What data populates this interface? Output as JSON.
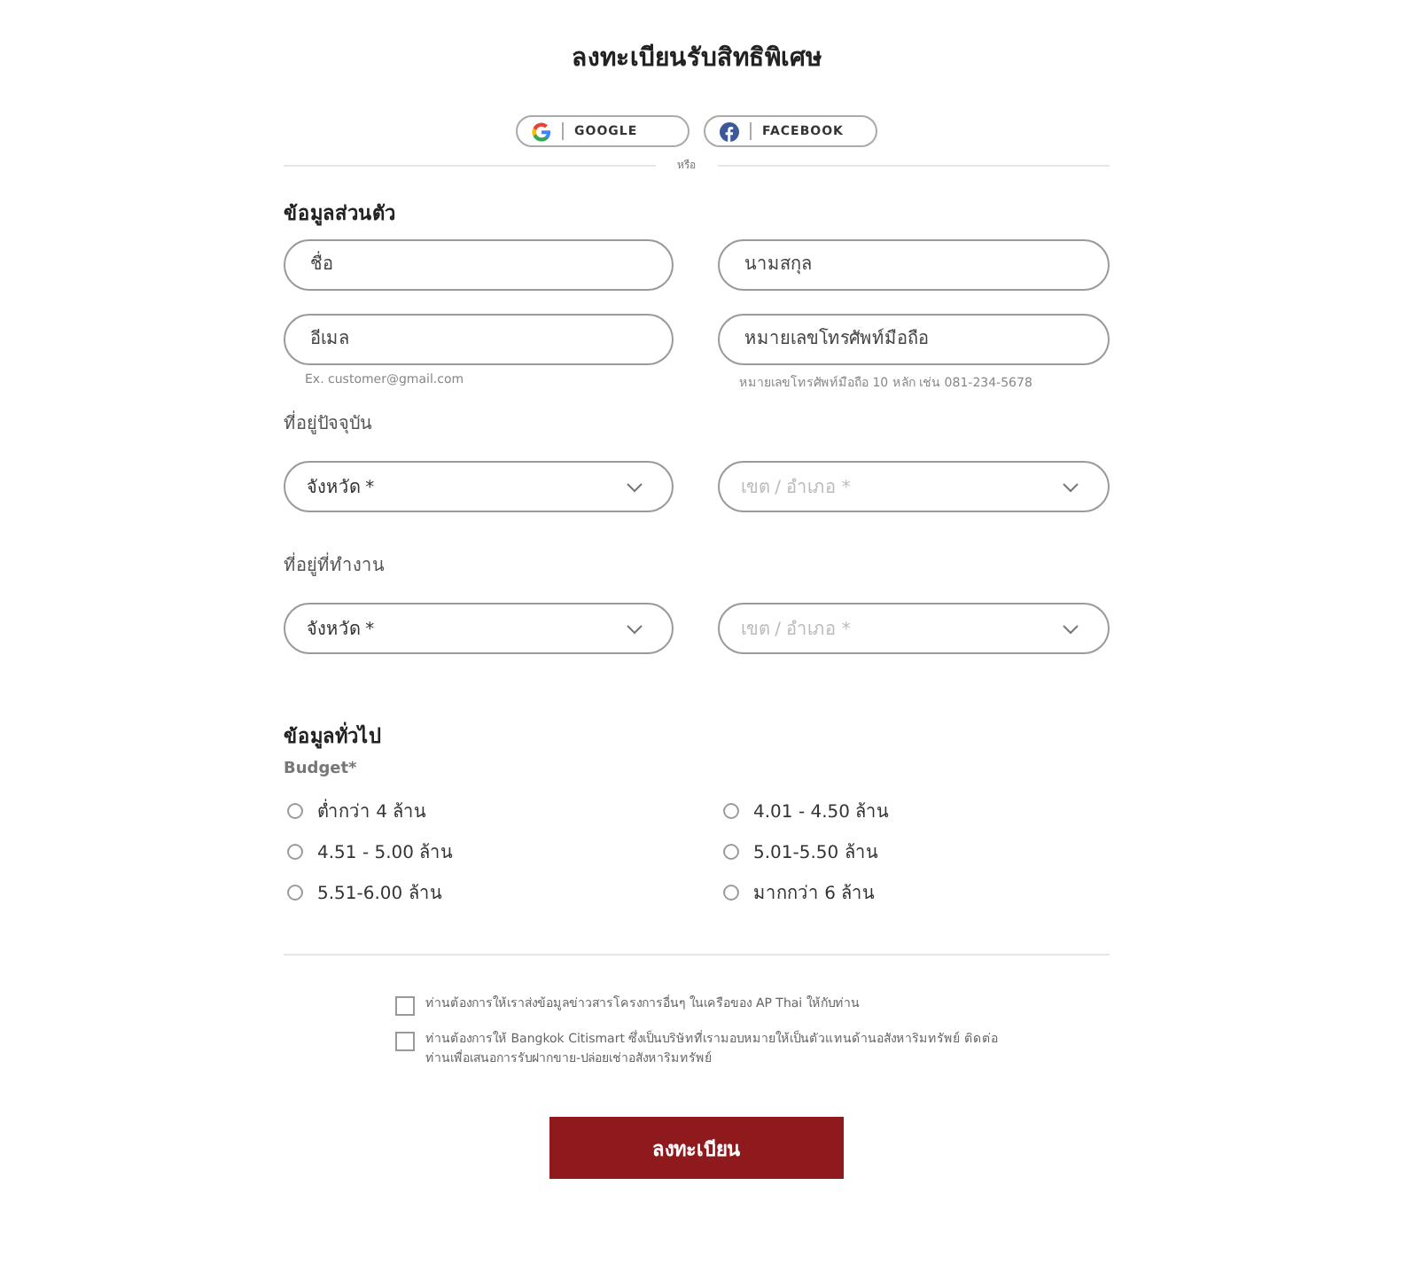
{
  "title": "ลงทะเบียนรับสิทธิพิเศษ",
  "social_buttons": [
    {
      "kind": "google",
      "label": "GOOGLE"
    },
    {
      "kind": "facebook",
      "label": "FACEBOOK"
    }
  ],
  "divider_text": "หรือ",
  "personal": {
    "heading": "ข้อมูลส่วนตัว",
    "fields": [
      {
        "placeholder": "ชื่อ"
      },
      {
        "placeholder": "นามสกุล"
      },
      {
        "placeholder": "อีเมล",
        "hint": "Ex. customer@gmail.com"
      },
      {
        "placeholder": "หมายเลขโทรศัพท์มือถือ",
        "hint": "หมายเลขโทรศัพท์มือถือ 10 หลัก เช่น 081-234-5678"
      }
    ]
  },
  "addresses": [
    {
      "label": "ที่อยู่ปัจจุบัน",
      "selects": [
        {
          "placeholder": "จังหวัด *",
          "disabled": false
        },
        {
          "placeholder": "เขต / อำเภอ *",
          "disabled": true
        }
      ]
    },
    {
      "label": "ที่อยู่ที่ทำงาน",
      "selects": [
        {
          "placeholder": "จังหวัด *",
          "disabled": false
        },
        {
          "placeholder": "เขต / อำเภอ *",
          "disabled": true
        }
      ]
    }
  ],
  "general": {
    "heading": "ข้อมูลทั่วไป",
    "budget_label": "Budget*",
    "options": [
      {
        "label": "ต่ำกว่า 4 ล้าน",
        "selected": false
      },
      {
        "label": "4.01 - 4.50 ล้าน",
        "selected": false
      },
      {
        "label": "4.51 - 5.00 ล้าน",
        "selected": false
      },
      {
        "label": "5.01-5.50 ล้าน",
        "selected": false
      },
      {
        "label": "5.51-6.00 ล้าน",
        "selected": false
      },
      {
        "label": "มากกว่า 6 ล้าน",
        "selected": false
      }
    ]
  },
  "consents": [
    {
      "text": "ท่านต้องการให้เราส่งข้อมูลข่าวสารโครงการอื่นๆ ในเครือของ AP Thai ให้กับท่าน",
      "checked": false
    },
    {
      "text": "ท่านต้องการให้ Bangkok Citismart ซึ่งเป็นบริษัทที่เรามอบหมายให้เป็นตัวแทนด้านอสังหาริมทรัพย์ ติดต่อท่านเพื่อเสนอการรับฝากขาย-ปล่อยเช่าอสังหาริมทรัพย์",
      "checked": false
    }
  ],
  "submit": "ลงทะเบียน"
}
